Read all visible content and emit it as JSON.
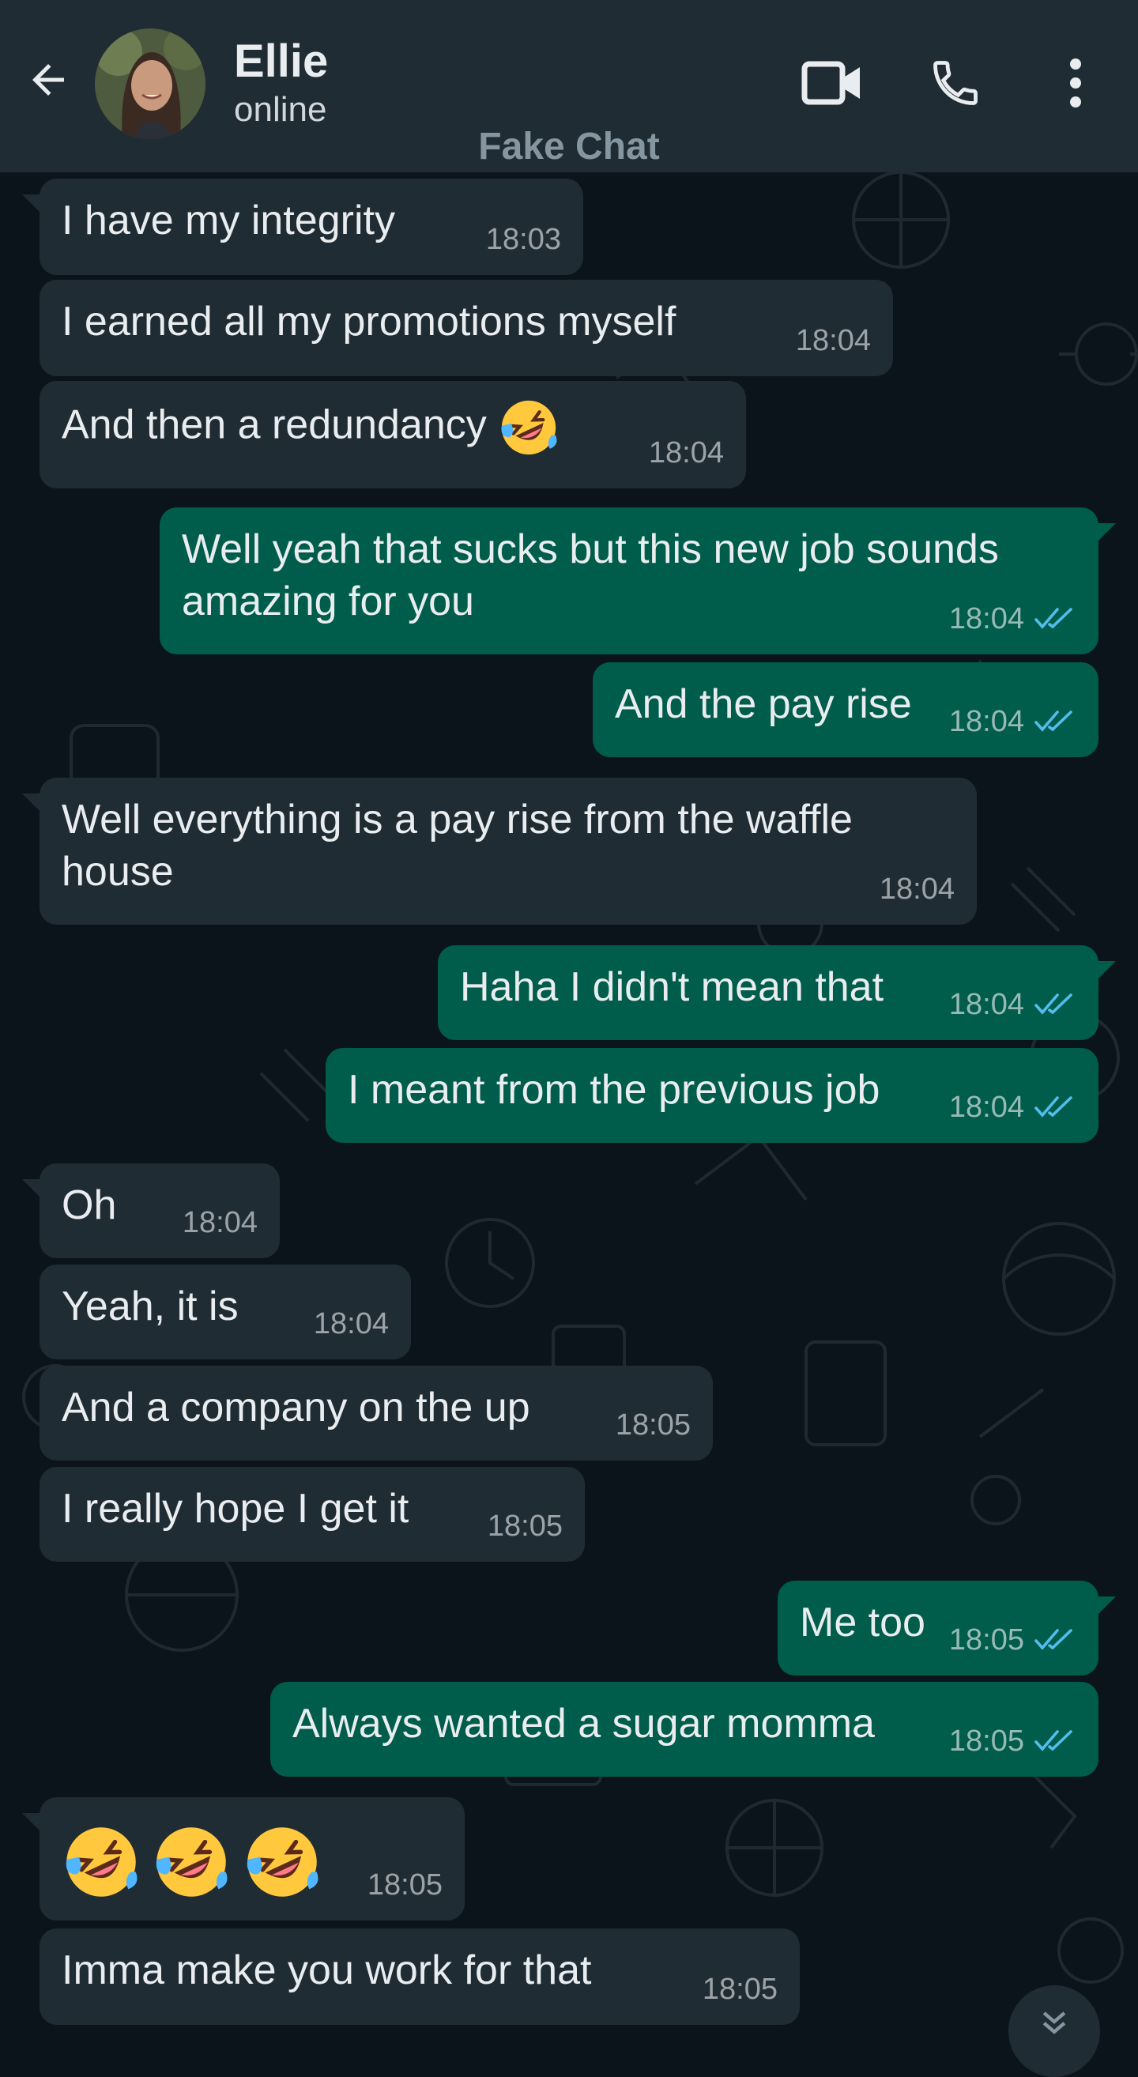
{
  "header": {
    "contact_name": "Ellie",
    "status": "online",
    "watermark": "Fake Chat",
    "icons": [
      "back-arrow-icon",
      "video-call-icon",
      "phone-call-icon",
      "more-options-icon"
    ]
  },
  "colors": {
    "header_bg": "#202c33",
    "chat_bg": "#0b141a",
    "incoming_bubble": "#202c33",
    "outgoing_bubble": "#005c4b",
    "read_ticks": "#53bdeb"
  },
  "messages": [
    {
      "dir": "in",
      "text": "I have my integrity",
      "time": "18:03"
    },
    {
      "dir": "in",
      "text": "I earned all my promotions myself",
      "time": "18:04"
    },
    {
      "dir": "in",
      "text": "And then a redundancy",
      "emoji": "rofl",
      "time": "18:04"
    },
    {
      "dir": "out",
      "text": "Well yeah that sucks but this new job sounds amazing for you",
      "time": "18:04",
      "read": true
    },
    {
      "dir": "out",
      "text": "And the pay rise",
      "time": "18:04",
      "read": true
    },
    {
      "dir": "in",
      "text": "Well everything is a pay rise from the waffle house",
      "time": "18:04"
    },
    {
      "dir": "out",
      "text": "Haha I didn't mean that",
      "time": "18:04",
      "read": true
    },
    {
      "dir": "out",
      "text": "I meant from the previous job",
      "time": "18:04",
      "read": true
    },
    {
      "dir": "in",
      "text": "Oh",
      "time": "18:04"
    },
    {
      "dir": "in",
      "text": "Yeah, it is",
      "time": "18:04"
    },
    {
      "dir": "in",
      "text": "And a company on the up",
      "time": "18:05"
    },
    {
      "dir": "in",
      "text": "I really hope I get it",
      "time": "18:05"
    },
    {
      "dir": "out",
      "text": "Me too",
      "time": "18:05",
      "read": true
    },
    {
      "dir": "out",
      "text": "Always wanted a sugar momma",
      "time": "18:05",
      "read": true
    },
    {
      "dir": "in",
      "text": "",
      "emoji": "rofl x3",
      "time": "18:05"
    },
    {
      "dir": "in",
      "text": "Imma make you work for that",
      "time": "18:05"
    }
  ]
}
